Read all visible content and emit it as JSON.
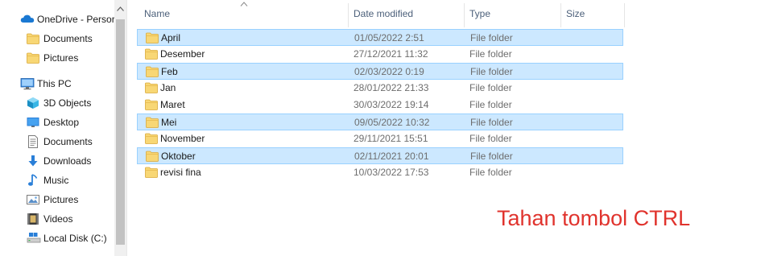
{
  "nav": {
    "items": [
      {
        "label": "OneDrive - Persor",
        "icon": "onedrive-cloud-icon",
        "level": 0
      },
      {
        "label": "Documents",
        "icon": "folder-icon",
        "level": 1
      },
      {
        "label": "Pictures",
        "icon": "folder-icon",
        "level": 1
      },
      {
        "label": "This PC",
        "icon": "this-pc-icon",
        "level": 0
      },
      {
        "label": "3D Objects",
        "icon": "3d-objects-icon",
        "level": 1
      },
      {
        "label": "Desktop",
        "icon": "desktop-icon",
        "level": 1
      },
      {
        "label": "Documents",
        "icon": "documents-icon",
        "level": 1
      },
      {
        "label": "Downloads",
        "icon": "downloads-icon",
        "level": 1
      },
      {
        "label": "Music",
        "icon": "music-icon",
        "level": 1
      },
      {
        "label": "Pictures",
        "icon": "pictures-icon",
        "level": 1
      },
      {
        "label": "Videos",
        "icon": "videos-icon",
        "level": 1
      },
      {
        "label": "Local Disk (C:)",
        "icon": "local-disk-icon",
        "level": 1
      }
    ]
  },
  "columns": {
    "name": "Name",
    "date": "Date modified",
    "type": "Type",
    "size": "Size"
  },
  "files": [
    {
      "name": "April",
      "date": "01/05/2022 2:51",
      "type": "File folder",
      "selected": true
    },
    {
      "name": "Desember",
      "date": "27/12/2021 11:32",
      "type": "File folder",
      "selected": false
    },
    {
      "name": "Feb",
      "date": "02/03/2022 0:19",
      "type": "File folder",
      "selected": true
    },
    {
      "name": "Jan",
      "date": "28/01/2022 21:33",
      "type": "File folder",
      "selected": false
    },
    {
      "name": "Maret",
      "date": "30/03/2022 19:14",
      "type": "File folder",
      "selected": false
    },
    {
      "name": "Mei",
      "date": "09/05/2022 10:32",
      "type": "File folder",
      "selected": true
    },
    {
      "name": "November",
      "date": "29/11/2021 15:51",
      "type": "File folder",
      "selected": false
    },
    {
      "name": "Oktober",
      "date": "02/11/2021 20:01",
      "type": "File folder",
      "selected": true
    },
    {
      "name": "revisi fina",
      "date": "10/03/2022 17:53",
      "type": "File folder",
      "selected": false
    }
  ],
  "annotation": "Tahan tombol CTRL",
  "colors": {
    "selection_bg": "#cce8ff",
    "selection_border": "#99d1ff",
    "folder_yellow": "#f8d775",
    "annotation_red": "#e0332d",
    "header_text": "#4c607a"
  }
}
